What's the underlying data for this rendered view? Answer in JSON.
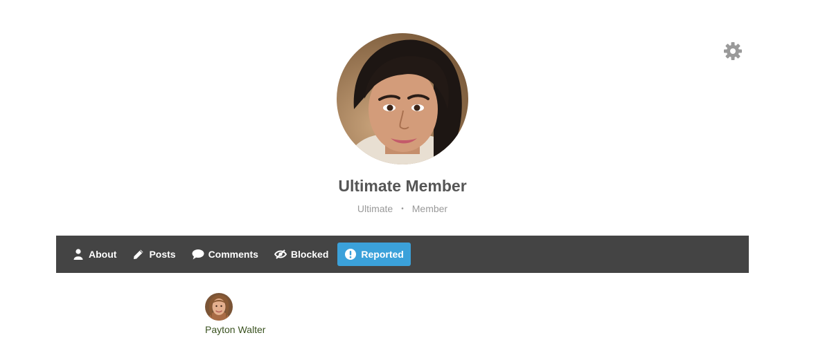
{
  "header": {
    "settings_icon": "gear-icon",
    "profile_photo_icon": "profile-photo",
    "name": "Ultimate Member",
    "meta": {
      "first": "Ultimate",
      "separator": "•",
      "second": "Member"
    }
  },
  "nav": {
    "background": "#444444",
    "active_color": "#3ba1da",
    "items": [
      {
        "label": "About",
        "icon": "user-icon"
      },
      {
        "label": "Posts",
        "icon": "pencil-icon"
      },
      {
        "label": "Comments",
        "icon": "comment-icon"
      },
      {
        "label": "Blocked",
        "icon": "eye-slash-icon"
      },
      {
        "label": "Reported",
        "icon": "exclamation-circle-icon",
        "active": true
      }
    ]
  },
  "reported": {
    "users": [
      {
        "name": "Payton Walter",
        "avatar_icon": "user-avatar"
      }
    ]
  }
}
